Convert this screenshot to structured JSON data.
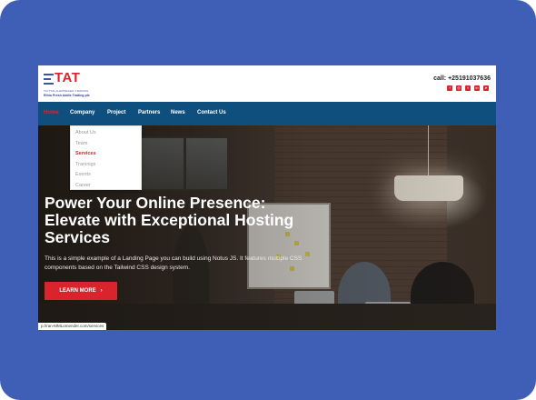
{
  "brand": {
    "logo_text": "TAT",
    "tagline": "TAYTAN ALEMSEGED TRADING",
    "company_name": "Ethio Fresh Addis Trading",
    "company_suffix": "plc",
    "accent_color": "#d9242e",
    "brand_blue": "#3c55a5"
  },
  "contact": {
    "phone": "call: +25191037636",
    "socials": [
      {
        "icon": "facebook-icon",
        "glyph": "f"
      },
      {
        "icon": "instagram-icon",
        "glyph": "◎"
      },
      {
        "icon": "twitter-icon",
        "glyph": "t"
      },
      {
        "icon": "linkedin-icon",
        "glyph": "in"
      },
      {
        "icon": "telegram-icon",
        "glyph": "➤"
      }
    ]
  },
  "nav": {
    "items": [
      {
        "label": "Home",
        "active": true
      },
      {
        "label": "Company",
        "active": false
      },
      {
        "label": "Project",
        "active": false
      },
      {
        "label": "Partners",
        "active": false
      },
      {
        "label": "News",
        "active": false
      },
      {
        "label": "Contact Us",
        "active": false
      }
    ],
    "background": "#0f4f7e"
  },
  "dropdown": {
    "items": [
      {
        "label": "About Us",
        "active": false
      },
      {
        "label": "Team",
        "active": false
      },
      {
        "label": "Services",
        "active": true
      },
      {
        "label": "Traninigs",
        "active": false
      },
      {
        "label": "Events",
        "active": false
      },
      {
        "label": "Career",
        "active": false
      }
    ]
  },
  "hero": {
    "headline": "Power Your Online Presence: Elevate with Exceptional Hosting Services",
    "subtext": "This is a simple example of a Landing Page you can build using Notus JS. It features multiple CSS components based on the Tailwind CSS design system.",
    "cta_label": "LEARN MORE",
    "cta_icon": "chevron-right-icon"
  },
  "status_bar": {
    "url": "p://ran-MMLomender.com/services"
  }
}
